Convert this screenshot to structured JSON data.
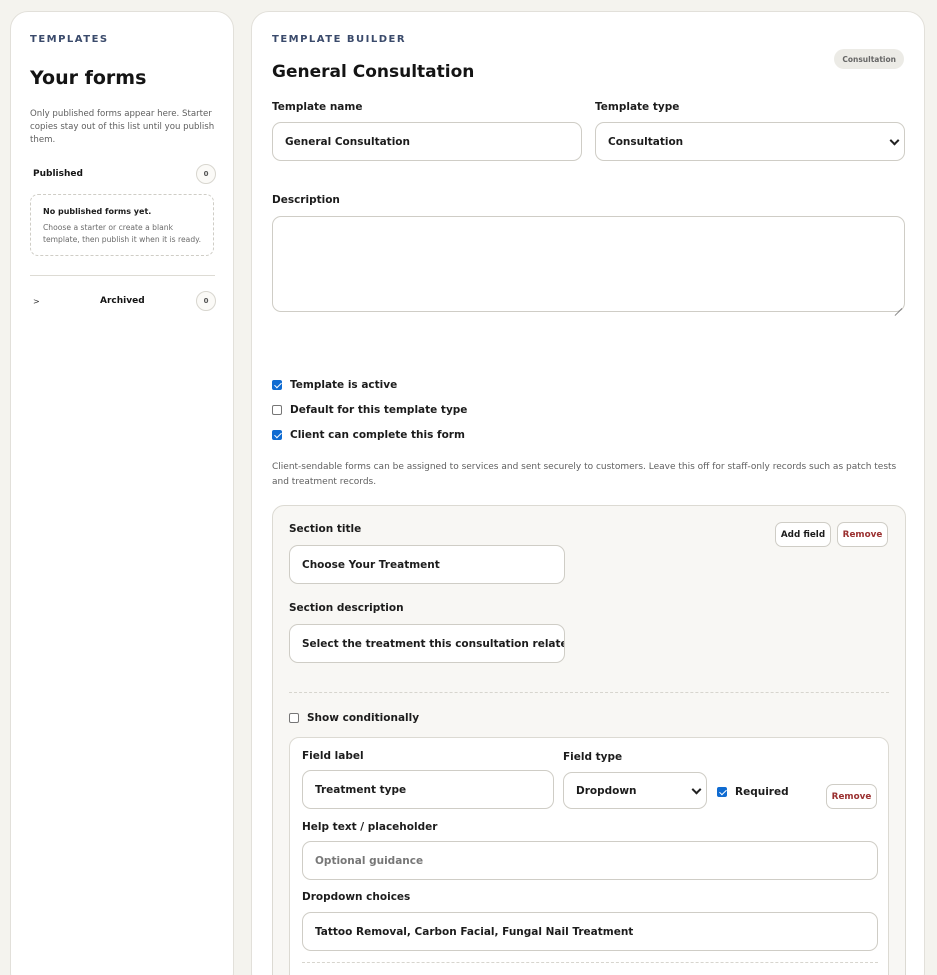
{
  "sidebar": {
    "eyebrow": "TEMPLATES",
    "title": "Your forms",
    "note": "Only published forms appear here. Starter copies stay out of this list until you publish them.",
    "published": {
      "label": "Published",
      "count": "0"
    },
    "empty": {
      "title": "No published forms yet.",
      "description": "Choose a starter or create a blank template, then publish it when it is ready."
    },
    "archived": {
      "chevron": ">",
      "label": "Archived",
      "count": "0"
    }
  },
  "builder": {
    "eyebrow": "TEMPLATE BUILDER",
    "title": "General Consultation",
    "type_chip": "Consultation",
    "name_label": "Template name",
    "name_value": "General Consultation",
    "type_label": "Template type",
    "type_value": "Consultation",
    "description_label": "Description",
    "description_value": "",
    "options": [
      {
        "label": "Template is active",
        "checked": true
      },
      {
        "label": "Default for this template type",
        "checked": false
      },
      {
        "label": "Client can complete this form",
        "checked": true
      }
    ],
    "helper_text": "Client-sendable forms can be assigned to services and sent securely to customers. Leave this off for staff-only records such as patch tests and treatment records."
  },
  "section": {
    "title_label": "Section title",
    "title_value": "Choose Your Treatment",
    "description_label": "Section description",
    "description_value": "Select the treatment this consultation relates to",
    "add_field_label": "Add field",
    "remove_label": "Remove",
    "show_conditionally_label": "Show conditionally",
    "show_conditionally_checked": false,
    "field": {
      "label_label": "Field label",
      "label_value": "Treatment type",
      "type_label": "Field type",
      "type_value": "Dropdown",
      "required_label": "Required",
      "required_checked": true,
      "remove_label": "Remove",
      "help_label": "Help text / placeholder",
      "help_placeholder": "Optional guidance",
      "choices_label": "Dropdown choices",
      "choices_value": "Tattoo Removal, Carbon Facial, Fungal Nail Treatment"
    }
  },
  "colors": {
    "accent": "#0f6bd1",
    "danger": "#9a2f2f",
    "page_bg": "#f4f3ee",
    "eyebrow": "#3a4a6b"
  }
}
